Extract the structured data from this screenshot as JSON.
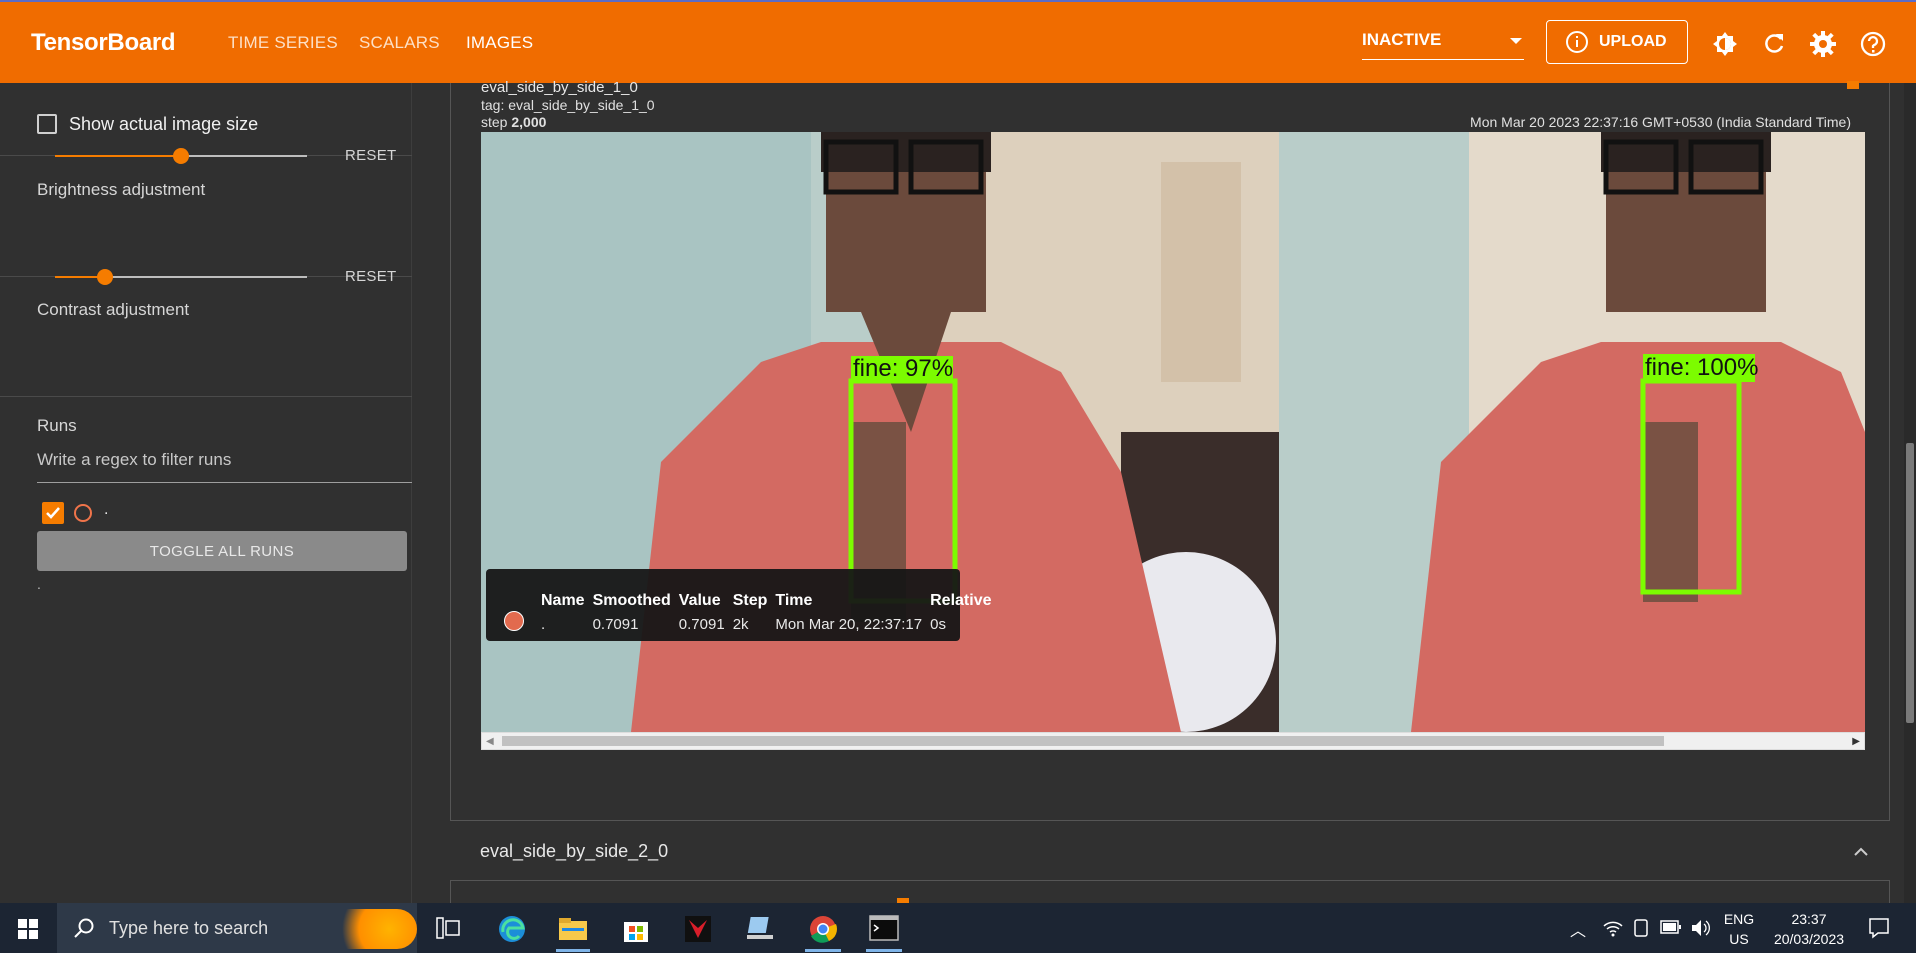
{
  "header": {
    "brand": "TensorBoard",
    "tabs": [
      {
        "label": "TIME SERIES"
      },
      {
        "label": "SCALARS"
      },
      {
        "label": "IMAGES"
      }
    ],
    "active_tab": "IMAGES",
    "run_selector_value": "INACTIVE",
    "upload_label": "UPLOAD",
    "accent": "#f06c00"
  },
  "sidebar": {
    "show_actual_label": "Show actual image size",
    "brightness_label": "Brightness adjustment",
    "brightness_value": 0.5,
    "contrast_label": "Contrast adjustment",
    "contrast_value": 0.2,
    "reset_label": "RESET",
    "runs_title": "Runs",
    "runs_filter_placeholder": "Write a regex to filter runs",
    "run_name": ".",
    "toggle_all_label": "TOGGLE ALL RUNS",
    "footer_text": "."
  },
  "card": {
    "name": "eval_side_by_side_1_0",
    "tag_line": "tag: eval_side_by_side_1_0",
    "step_prefix": "step",
    "step_value": "2,000",
    "timestamp": "Mon Mar 20 2023 22:37:16 GMT+0530 (India Standard Time)",
    "left_label": "fine: 97%",
    "right_label": "fine: 100%"
  },
  "tooltip": {
    "headers": [
      "Name",
      "Smoothed",
      "Value",
      "Step",
      "Time",
      "Relative"
    ],
    "row": [
      ".",
      "0.7091",
      "0.7091",
      "2k",
      "Mon Mar 20, 22:37:17",
      "0s"
    ]
  },
  "next_card": {
    "name": "eval_side_by_side_2_0"
  },
  "taskbar": {
    "search_placeholder": "Type here to search",
    "lang_top": "ENG",
    "lang_bottom": "US",
    "time": "23:37",
    "date": "20/03/2023"
  }
}
